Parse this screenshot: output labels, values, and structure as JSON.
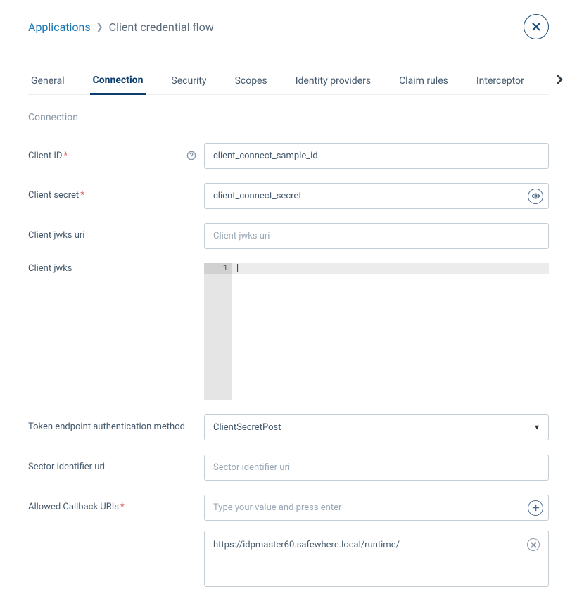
{
  "breadcrumb": {
    "parent": "Applications",
    "current": "Client credential flow"
  },
  "tabs": {
    "items": [
      {
        "label": "General"
      },
      {
        "label": "Connection"
      },
      {
        "label": "Security"
      },
      {
        "label": "Scopes"
      },
      {
        "label": "Identity providers"
      },
      {
        "label": "Claim rules"
      },
      {
        "label": "Interceptor"
      }
    ],
    "active_index": 1
  },
  "section_title": "Connection",
  "fields": {
    "client_id": {
      "label": "Client ID",
      "required": true,
      "value": "client_connect_sample_id"
    },
    "client_secret": {
      "label": "Client secret",
      "required": true,
      "value": "client_connect_secret"
    },
    "client_jwks_uri": {
      "label": "Client jwks uri",
      "placeholder": "Client jwks uri",
      "value": ""
    },
    "client_jwks": {
      "label": "Client jwks",
      "line_number": "1",
      "value": ""
    },
    "token_auth": {
      "label": "Token endpoint authentication method",
      "value": "ClientSecretPost"
    },
    "sector_identifier": {
      "label": "Sector identifier uri",
      "placeholder": "Sector identifier uri",
      "value": ""
    },
    "allowed_callback": {
      "label": "Allowed Callback URIs",
      "required": true,
      "placeholder": "Type your value and press enter",
      "items": [
        "https://idpmaster60.safewhere.local/runtime/"
      ]
    }
  }
}
